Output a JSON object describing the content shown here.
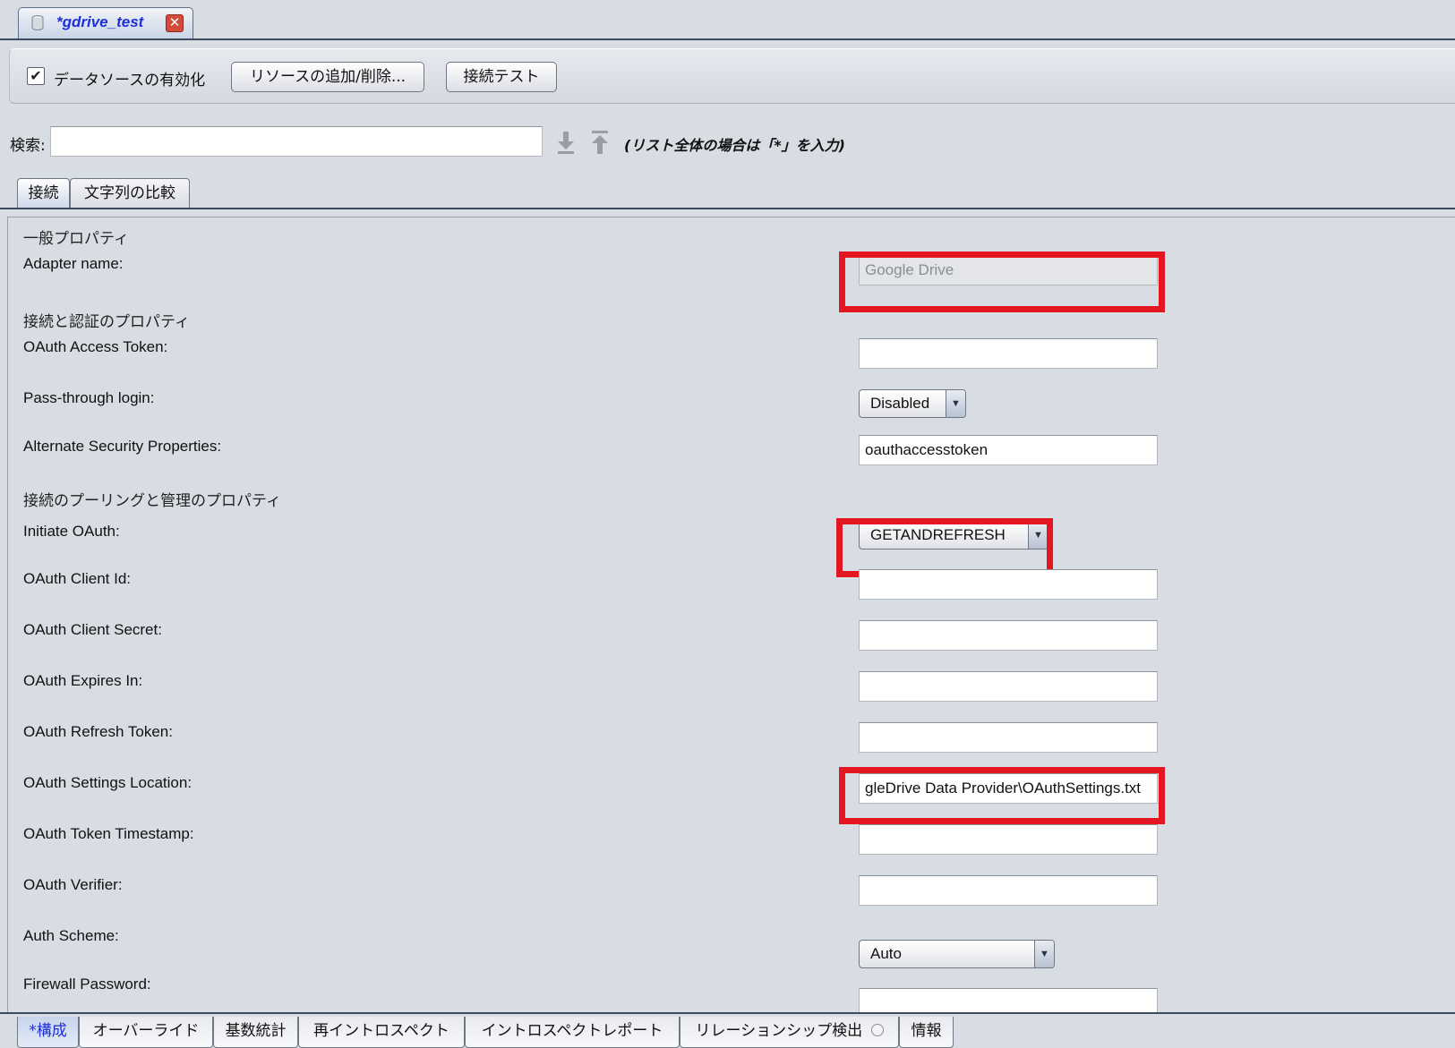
{
  "editor_tab": {
    "title": "*gdrive_test"
  },
  "toolbar": {
    "enable_label": "データソースの有効化",
    "enable_checked": true,
    "add_remove_label": "リソースの追加/削除...",
    "test_label": "接続テスト"
  },
  "search": {
    "label": "検索:",
    "value": "",
    "hint": "(リスト全体の場合は「*」を入力)"
  },
  "inner_tabs": [
    "接続",
    "文字列の比較"
  ],
  "sections": {
    "general": "一般プロパティ",
    "auth": "接続と認証のプロパティ",
    "pooling": "接続のプーリングと管理のプロパティ"
  },
  "properties": {
    "adapter_name": {
      "label": "Adapter name:",
      "value": "Google Drive"
    },
    "oauth_access_token": {
      "label": "OAuth Access Token:",
      "value": ""
    },
    "pass_through_login": {
      "label": "Pass-through login:",
      "value": "Disabled"
    },
    "alternate_security": {
      "label": "Alternate Security Properties:",
      "value": "oauthaccesstoken"
    },
    "initiate_oauth": {
      "label": "Initiate OAuth:",
      "value": "GETANDREFRESH"
    },
    "oauth_client_id": {
      "label": "OAuth Client Id:",
      "value": ""
    },
    "oauth_client_secret": {
      "label": "OAuth Client Secret:",
      "value": ""
    },
    "oauth_expires_in": {
      "label": "OAuth Expires In:",
      "value": ""
    },
    "oauth_refresh_token": {
      "label": "OAuth Refresh Token:",
      "value": ""
    },
    "oauth_settings_location": {
      "label": "OAuth Settings Location:",
      "value": "gleDrive Data Provider\\OAuthSettings.txt"
    },
    "oauth_token_timestamp": {
      "label": "OAuth Token Timestamp:",
      "value": ""
    },
    "oauth_verifier": {
      "label": "OAuth Verifier:",
      "value": ""
    },
    "auth_scheme": {
      "label": "Auth Scheme:",
      "value": "Auto"
    },
    "firewall_password": {
      "label": "Firewall Password:",
      "value": ""
    }
  },
  "bottom_tabs": [
    "*構成",
    "オーバーライド",
    "基数統計",
    "再イントロスペクト",
    "イントロスペクトレポート",
    "リレーションシップ検出",
    "情報"
  ],
  "colors": {
    "highlight": "#e31621",
    "accent": "#1d2fd6"
  }
}
